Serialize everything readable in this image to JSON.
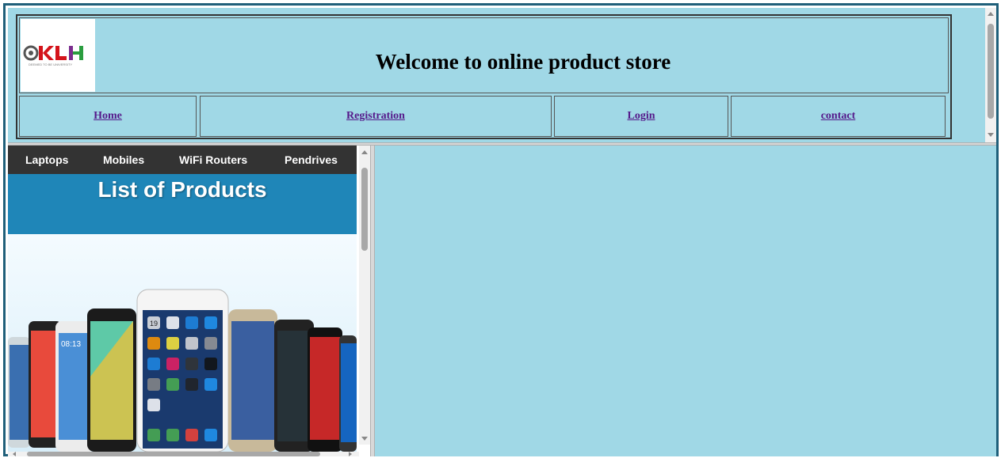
{
  "header": {
    "logo_text": "KLH",
    "logo_subtext": "DEEMED TO BE UNIVERSITY",
    "title": "Welcome to online product store"
  },
  "nav": {
    "home": "Home",
    "registration": "Registration",
    "login": "Login",
    "contact": "contact"
  },
  "categories": {
    "laptops": "Laptops",
    "mobiles": "Mobiles",
    "wifi_routers": "WiFi Routers",
    "pendrives": "Pendrives"
  },
  "banner": {
    "title": "List of Products"
  },
  "phone_screen": {
    "time_left": "08:13",
    "icon_label": "19"
  },
  "colors": {
    "frame_bg": "#a0d8e6",
    "nav_bar": "#333333",
    "banner_bg": "#1f86b8",
    "link": "#551a8b",
    "outer_border": "#1f5f7a"
  }
}
